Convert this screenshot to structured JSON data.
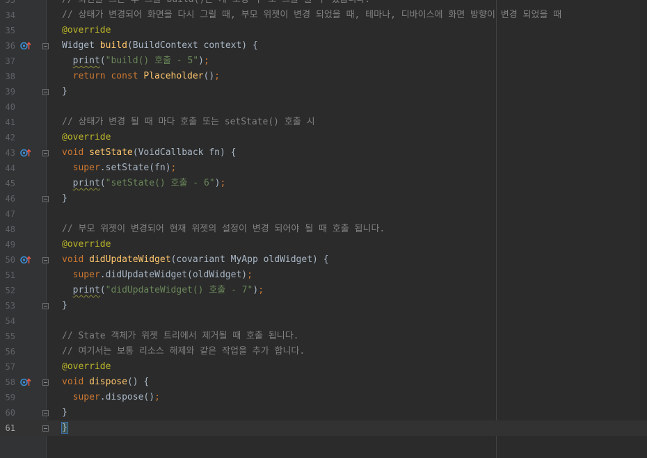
{
  "editor": {
    "language": "Dart",
    "current_line": 61,
    "colors": {
      "background": "#2b2b2b",
      "comment": "#808080",
      "annotation": "#bbb529",
      "keyword": "#cc7832",
      "function": "#ffc66d",
      "string": "#6a8759",
      "text": "#a9b7c6"
    },
    "lines": [
      {
        "num": "33",
        "segments": [
          {
            "c": "cm",
            "t": "// 화면을 그는 후 그를 build()는 계 모정 수 도 그를 을 수 있습니다."
          }
        ]
      },
      {
        "num": "34",
        "segments": [
          {
            "c": "cm",
            "t": "// 상태가 변경되어 화면을 다시 그릴 때, 부모 위젯이 변경 되었을 때, 테마나, 디바이스에 화면 방향이 변경 되었을 때"
          }
        ]
      },
      {
        "num": "35",
        "segments": [
          {
            "c": "an",
            "t": "@override"
          }
        ]
      },
      {
        "num": "36",
        "icon": "override-gutter-icon",
        "fold": true,
        "segments": [
          {
            "c": "tp",
            "t": "Widget "
          },
          {
            "c": "fn",
            "t": "build"
          },
          {
            "c": "tx",
            "t": "(BuildContext context) {"
          }
        ]
      },
      {
        "num": "37",
        "segments": [
          {
            "c": "tx",
            "t": "  "
          },
          {
            "c": "tx wavy",
            "t": "print"
          },
          {
            "c": "tx",
            "t": "("
          },
          {
            "c": "st",
            "t": "\"build() 호출 - 5\""
          },
          {
            "c": "tx",
            "t": ")"
          },
          {
            "c": "kw",
            "t": ";"
          }
        ]
      },
      {
        "num": "38",
        "segments": [
          {
            "c": "tx",
            "t": "  "
          },
          {
            "c": "kw",
            "t": "return const "
          },
          {
            "c": "fn",
            "t": "Placeholder"
          },
          {
            "c": "tx",
            "t": "()"
          },
          {
            "c": "kw",
            "t": ";"
          }
        ]
      },
      {
        "num": "39",
        "fold": true,
        "segments": [
          {
            "c": "tx",
            "t": "}"
          }
        ]
      },
      {
        "num": "40",
        "segments": []
      },
      {
        "num": "41",
        "segments": [
          {
            "c": "cm",
            "t": "// 상태가 변경 될 때 마다 호출 또는 setState() 호출 시"
          }
        ]
      },
      {
        "num": "42",
        "segments": [
          {
            "c": "an",
            "t": "@override"
          }
        ]
      },
      {
        "num": "43",
        "icon": "override-gutter-icon",
        "fold": true,
        "segments": [
          {
            "c": "kw",
            "t": "void "
          },
          {
            "c": "fn",
            "t": "setState"
          },
          {
            "c": "tx",
            "t": "(VoidCallback fn) {"
          }
        ]
      },
      {
        "num": "44",
        "segments": [
          {
            "c": "tx",
            "t": "  "
          },
          {
            "c": "kw",
            "t": "super"
          },
          {
            "c": "tx",
            "t": ".setState(fn)"
          },
          {
            "c": "kw",
            "t": ";"
          }
        ]
      },
      {
        "num": "45",
        "segments": [
          {
            "c": "tx",
            "t": "  "
          },
          {
            "c": "tx wavy",
            "t": "print"
          },
          {
            "c": "tx",
            "t": "("
          },
          {
            "c": "st",
            "t": "\"setState() 호출 - 6\""
          },
          {
            "c": "tx",
            "t": ")"
          },
          {
            "c": "kw",
            "t": ";"
          }
        ]
      },
      {
        "num": "46",
        "fold": true,
        "segments": [
          {
            "c": "tx",
            "t": "}"
          }
        ]
      },
      {
        "num": "47",
        "segments": []
      },
      {
        "num": "48",
        "segments": [
          {
            "c": "cm",
            "t": "// 부모 위젯이 변경되어 현재 위젯의 설정이 변경 되어야 될 때 호출 됩니다."
          }
        ]
      },
      {
        "num": "49",
        "segments": [
          {
            "c": "an",
            "t": "@override"
          }
        ]
      },
      {
        "num": "50",
        "icon": "override-gutter-icon",
        "fold": true,
        "segments": [
          {
            "c": "kw",
            "t": "void "
          },
          {
            "c": "fn",
            "t": "didUpdateWidget"
          },
          {
            "c": "tx",
            "t": "(covariant MyApp oldWidget) {"
          }
        ]
      },
      {
        "num": "51",
        "segments": [
          {
            "c": "tx",
            "t": "  "
          },
          {
            "c": "kw",
            "t": "super"
          },
          {
            "c": "tx",
            "t": ".didUpdateWidget(oldWidget)"
          },
          {
            "c": "kw",
            "t": ";"
          }
        ]
      },
      {
        "num": "52",
        "segments": [
          {
            "c": "tx",
            "t": "  "
          },
          {
            "c": "tx wavy",
            "t": "print"
          },
          {
            "c": "tx",
            "t": "("
          },
          {
            "c": "st",
            "t": "\"didUpdateWidget() 호출 - 7\""
          },
          {
            "c": "tx",
            "t": ")"
          },
          {
            "c": "kw",
            "t": ";"
          }
        ]
      },
      {
        "num": "53",
        "fold": true,
        "segments": [
          {
            "c": "tx",
            "t": "}"
          }
        ]
      },
      {
        "num": "54",
        "segments": []
      },
      {
        "num": "55",
        "segments": [
          {
            "c": "cm",
            "t": "// State 객체가 위젯 트리에서 제거될 때 호출 됩니다."
          }
        ]
      },
      {
        "num": "56",
        "segments": [
          {
            "c": "cm",
            "t": "// 여기서는 보통 리소스 해제와 같은 작업을 추가 합니다."
          }
        ]
      },
      {
        "num": "57",
        "segments": [
          {
            "c": "an",
            "t": "@override"
          }
        ]
      },
      {
        "num": "58",
        "icon": "override-gutter-icon",
        "fold": true,
        "segments": [
          {
            "c": "kw",
            "t": "void "
          },
          {
            "c": "fn",
            "t": "dispose"
          },
          {
            "c": "tx",
            "t": "() {"
          }
        ]
      },
      {
        "num": "59",
        "segments": [
          {
            "c": "tx",
            "t": "  "
          },
          {
            "c": "kw",
            "t": "super"
          },
          {
            "c": "tx",
            "t": ".dispose()"
          },
          {
            "c": "kw",
            "t": ";"
          }
        ]
      },
      {
        "num": "60",
        "fold": true,
        "segments": [
          {
            "c": "tx",
            "t": "}"
          }
        ]
      },
      {
        "num": "61",
        "fold": true,
        "segments": [
          {
            "c": "tx brace-match",
            "t": "}"
          }
        ]
      }
    ]
  }
}
